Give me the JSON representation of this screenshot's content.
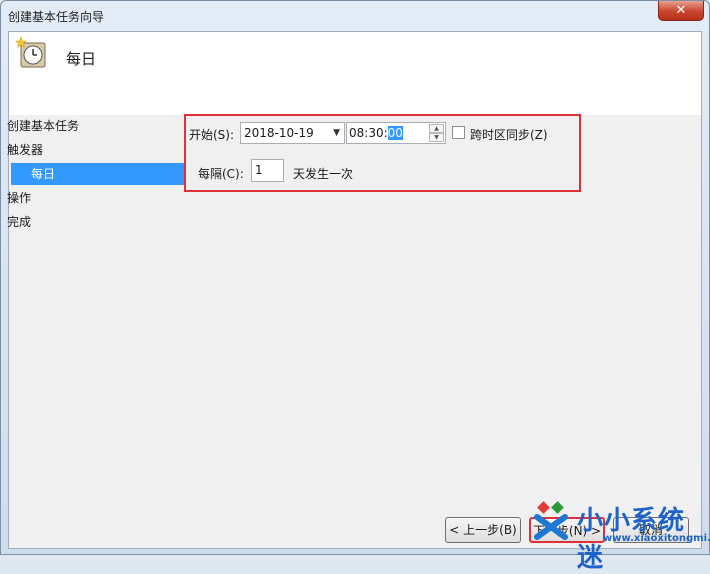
{
  "window": {
    "title": "创建基本任务向导",
    "close_glyph": "✕"
  },
  "header": {
    "title": "每日",
    "icon": "clock-star-icon"
  },
  "sidebar": {
    "items": [
      {
        "label": "创建基本任务"
      },
      {
        "label": "触发器"
      },
      {
        "label": "每日",
        "selected": true
      },
      {
        "label": "操作"
      },
      {
        "label": "完成"
      }
    ]
  },
  "form": {
    "start_label": "开始(S):",
    "start_date": "2018-10-19",
    "start_time_prefix": "08:30:",
    "start_time_selected": "00",
    "sync_timezone_label": "跨时区同步(Z)",
    "sync_timezone_checked": false,
    "recur_label": "每隔(C):",
    "recur_value": "1",
    "recur_suffix": "天发生一次"
  },
  "buttons": {
    "back": "< 上一步(B)",
    "next": "下一步(N) >",
    "cancel": "取消"
  },
  "watermark": {
    "text": "小小系统迷",
    "url": "www.xiaoxitongmi.com"
  },
  "colors": {
    "selection": "#3399ff",
    "highlight_box": "#e0303a",
    "close_button": "#c9452e"
  }
}
